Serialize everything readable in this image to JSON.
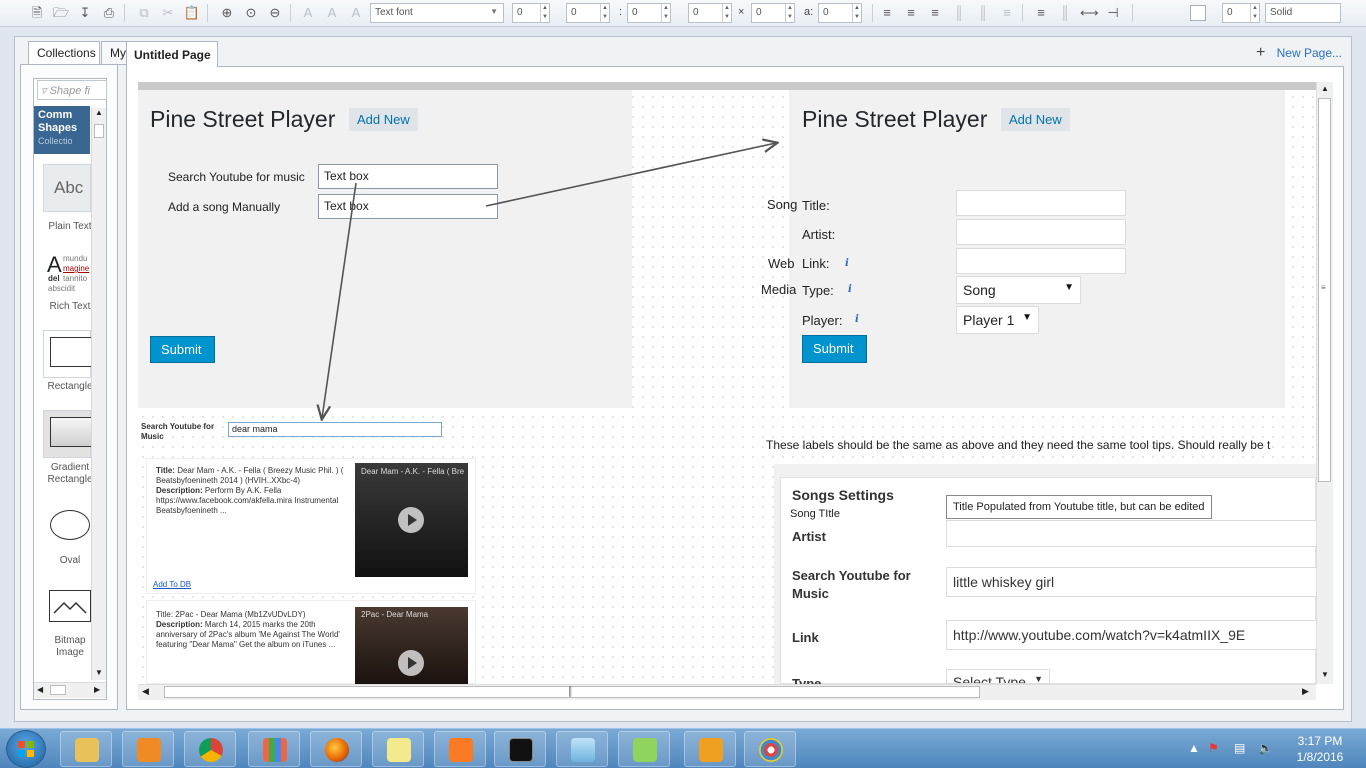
{
  "toolbar": {
    "font_field": "Text font",
    "font_size": "0",
    "spin_values": [
      "0",
      "0",
      "0",
      "0",
      "0",
      "0"
    ],
    "separator_colon": ":",
    "separator_x": "×",
    "separator_a": "a:",
    "line_width": "0",
    "line_style": "Solid"
  },
  "left_panel": {
    "tabs": [
      "Collections",
      "My Stuff"
    ],
    "filter_placeholder": "Shape fi",
    "category_title": "Comm Shapes",
    "category_sub": "Collectio",
    "shapes": [
      {
        "label": "Plain Text",
        "preview": "Abc"
      },
      {
        "label": "Rich Text",
        "preview": "A"
      },
      {
        "label": "Rectangle"
      },
      {
        "label": "Gradient Rectangle"
      },
      {
        "label": "Oval"
      },
      {
        "label": "Bitmap Image"
      }
    ],
    "rich_preview_words": [
      "mundu",
      "magine",
      "del",
      "tannito",
      "abscidit"
    ]
  },
  "page": {
    "tab_title": "Untitled Page",
    "new_page": "New Page..."
  },
  "mockup_left": {
    "title": "Pine Street Player",
    "add_new": "Add New",
    "search_label": "Search Youtube for music",
    "search_value": "Text box",
    "manual_label": "Add a song Manually",
    "manual_value": "Text box",
    "submit": "Submit"
  },
  "mockup_right": {
    "title": "Pine Street Player",
    "add_new": "Add New",
    "fields": [
      {
        "prefix": "Song",
        "label": "Title:"
      },
      {
        "prefix": "",
        "label": "Artist:"
      },
      {
        "prefix": "Web",
        "label": "Link:"
      },
      {
        "prefix": "Media",
        "label": "Type:"
      },
      {
        "prefix": "",
        "label": "Player:"
      }
    ],
    "type_value": "Song",
    "player_value": "Player 1",
    "submit": "Submit"
  },
  "youtube_results": {
    "search_label": "Search Youtube for Music",
    "search_value": "dear mama",
    "results": [
      {
        "title_prefix": "Title:",
        "title": "Dear Mam - A.K. - Fella ( Breezy Music Phil. ) ( Beatsbyfoenineth 2014 ) (HVIH..XXbc-4)",
        "desc_prefix": "Description:",
        "desc": "Perform By A.K. Fella https://www.facebook.com/akfella.mira Instrumental Beatsbyfoenineth ...",
        "thumb_caption": "Dear Mam - A.K. - Fella ( Bre",
        "add_link": "Add To DB"
      },
      {
        "title_prefix": "Title:",
        "title": "2Pac - Dear Mama (Mb1ZvUDvLDY)",
        "desc_prefix": "Description:",
        "desc": "March 14, 2015 marks the 20th anniversary of 2Pac's album 'Me Against The World' featuring \"Dear Mama\" Get the album on iTunes ...",
        "thumb_caption": "2Pac - Dear Mama"
      }
    ]
  },
  "note": "These labels should be the same as above and they need the same tool tips. Should really be t",
  "songs_settings": {
    "heading": "Songs Settings",
    "song_title_label": "Song TItle",
    "tooltip": "Title Populated from Youtube title, but can be edited",
    "artist_label": "Artist",
    "search_label": "Search Youtube for Music",
    "search_value": "little whiskey girl",
    "link_label": "Link",
    "link_value": "http://www.youtube.com/watch?v=k4atmIIX_9E",
    "type_label": "Type",
    "type_value": "Select Type"
  },
  "taskbar": {
    "time": "3:17 PM",
    "date": "1/8/2016",
    "apps": [
      "explorer",
      "media-player",
      "chrome",
      "app-grid",
      "firefox",
      "sticky-notes",
      "xampp",
      "command-prompt",
      "notepad",
      "notepad-plus-plus",
      "home-app",
      "paint"
    ]
  }
}
